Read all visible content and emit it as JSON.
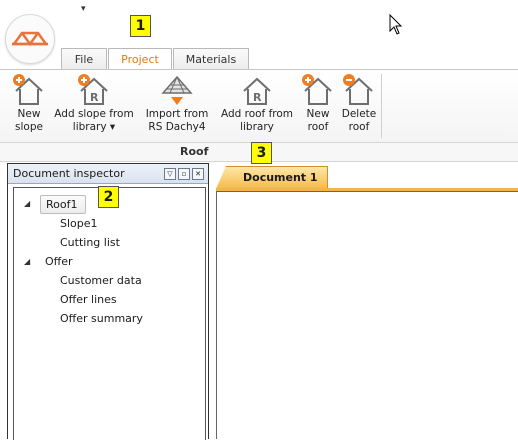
{
  "tabs": [
    {
      "label": "File"
    },
    {
      "label": "Project"
    },
    {
      "label": "Materials"
    }
  ],
  "active_tab": "Project",
  "callouts": [
    "1",
    "2",
    "3"
  ],
  "ribbon": {
    "buttons": [
      {
        "line1": "New",
        "line2": "slope",
        "icon": "house-add-icon"
      },
      {
        "line1": "Add slope from",
        "line2": "library ▾",
        "icon": "house-r-add-icon"
      },
      {
        "line1": "Import from",
        "line2": "RS Dachy4",
        "icon": "import-roof-icon"
      },
      {
        "line1": "Add roof from",
        "line2": "library",
        "icon": "house-r-icon"
      },
      {
        "line1": "New",
        "line2": "roof",
        "icon": "house-add-icon"
      },
      {
        "line1": "Delete",
        "line2": "roof",
        "icon": "house-remove-icon"
      }
    ],
    "group_label": "Roof"
  },
  "inspector": {
    "title": "Document inspector",
    "tree": {
      "roof1": "Roof1",
      "slope1": "Slope1",
      "cutting_list": "Cutting list",
      "offer": "Offer",
      "customer_data": "Customer data",
      "offer_lines": "Offer lines",
      "offer_summary": "Offer summary"
    }
  },
  "document_tab": "Document 1",
  "colors": {
    "accent_orange": "#e07a10",
    "callout_yellow": "#ffff00",
    "doc_tab": "#f6b94a"
  }
}
